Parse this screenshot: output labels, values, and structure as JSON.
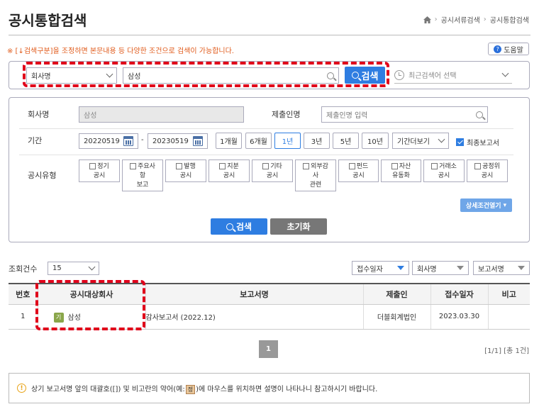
{
  "page_title": "공시통합검색",
  "breadcrumb": {
    "level1": "공시서류검색",
    "level2": "공시통합검색"
  },
  "notice": "※ [↓검색구분]을 조정하면 본문내용 등 다양한 조건으로 검색이 가능합니다.",
  "help_label": "도움말",
  "quick_search": {
    "type_value": "회사명",
    "query_value": "삼성",
    "search_label": "검색",
    "recent_placeholder": "최근검색어 선택"
  },
  "conditions": {
    "company_label": "회사명",
    "company_value": "삼성",
    "submitter_label": "제출인명",
    "submitter_placeholder": "제출인명 입력",
    "period_label": "기간",
    "date_from": "20220519",
    "date_sep": "-",
    "date_to": "20230519",
    "period_buttons": [
      {
        "label": "1개월",
        "active": false
      },
      {
        "label": "6개월",
        "active": false
      },
      {
        "label": "1년",
        "active": true
      },
      {
        "label": "3년",
        "active": false
      },
      {
        "label": "5년",
        "active": false
      },
      {
        "label": "10년",
        "active": false
      }
    ],
    "period_select": "기간더보기",
    "final_report_label": "최종보고서",
    "final_report_checked": true,
    "type_label": "공시유형",
    "types": [
      {
        "line1": "정기",
        "line2": "공시"
      },
      {
        "line1": "주요사",
        "line2": "항",
        "line3": "보고"
      },
      {
        "line1": "발행",
        "line2": "공시"
      },
      {
        "line1": "지분",
        "line2": "공시"
      },
      {
        "line1": "기타",
        "line2": "공시"
      },
      {
        "line1": "외부감",
        "line2": "사",
        "line3": "관련"
      },
      {
        "line1": "펀드",
        "line2": "공시"
      },
      {
        "line1": "자산",
        "line2": "유동화"
      },
      {
        "line1": "거래소",
        "line2": "공시"
      },
      {
        "line1": "공정위",
        "line2": "공시"
      }
    ],
    "detail_toggle": "상세조건열기",
    "search_label": "검색",
    "reset_label": "초기화"
  },
  "results": {
    "count_label": "조회건수",
    "count_value": "15",
    "sort1": "접수일자",
    "sort2": "회사명",
    "sort3": "보고서명",
    "columns": [
      "번호",
      "공시대상회사",
      "보고서명",
      "제출인",
      "접수일자",
      "비고"
    ],
    "rows": [
      {
        "no": "1",
        "badge": "기",
        "company": "삼성",
        "report": "감사보고서 (2022.12)",
        "submitter": "더블회계법인",
        "date": "2023.03.30",
        "note": ""
      }
    ],
    "page": "1",
    "page_count": "[1/1] [총 1건]"
  },
  "info": {
    "before": "상기 보고서명 앞의 대괄호([]) 및 비고란의 약어(예:",
    "sample": "정",
    "after": ")에 마우스를 위치하면 설명이 나타나니 참고하시기 바랍니다."
  },
  "colors": {
    "accent": "#2e7de1",
    "highlight": "#e0001a",
    "notice": "#e05a1a"
  }
}
